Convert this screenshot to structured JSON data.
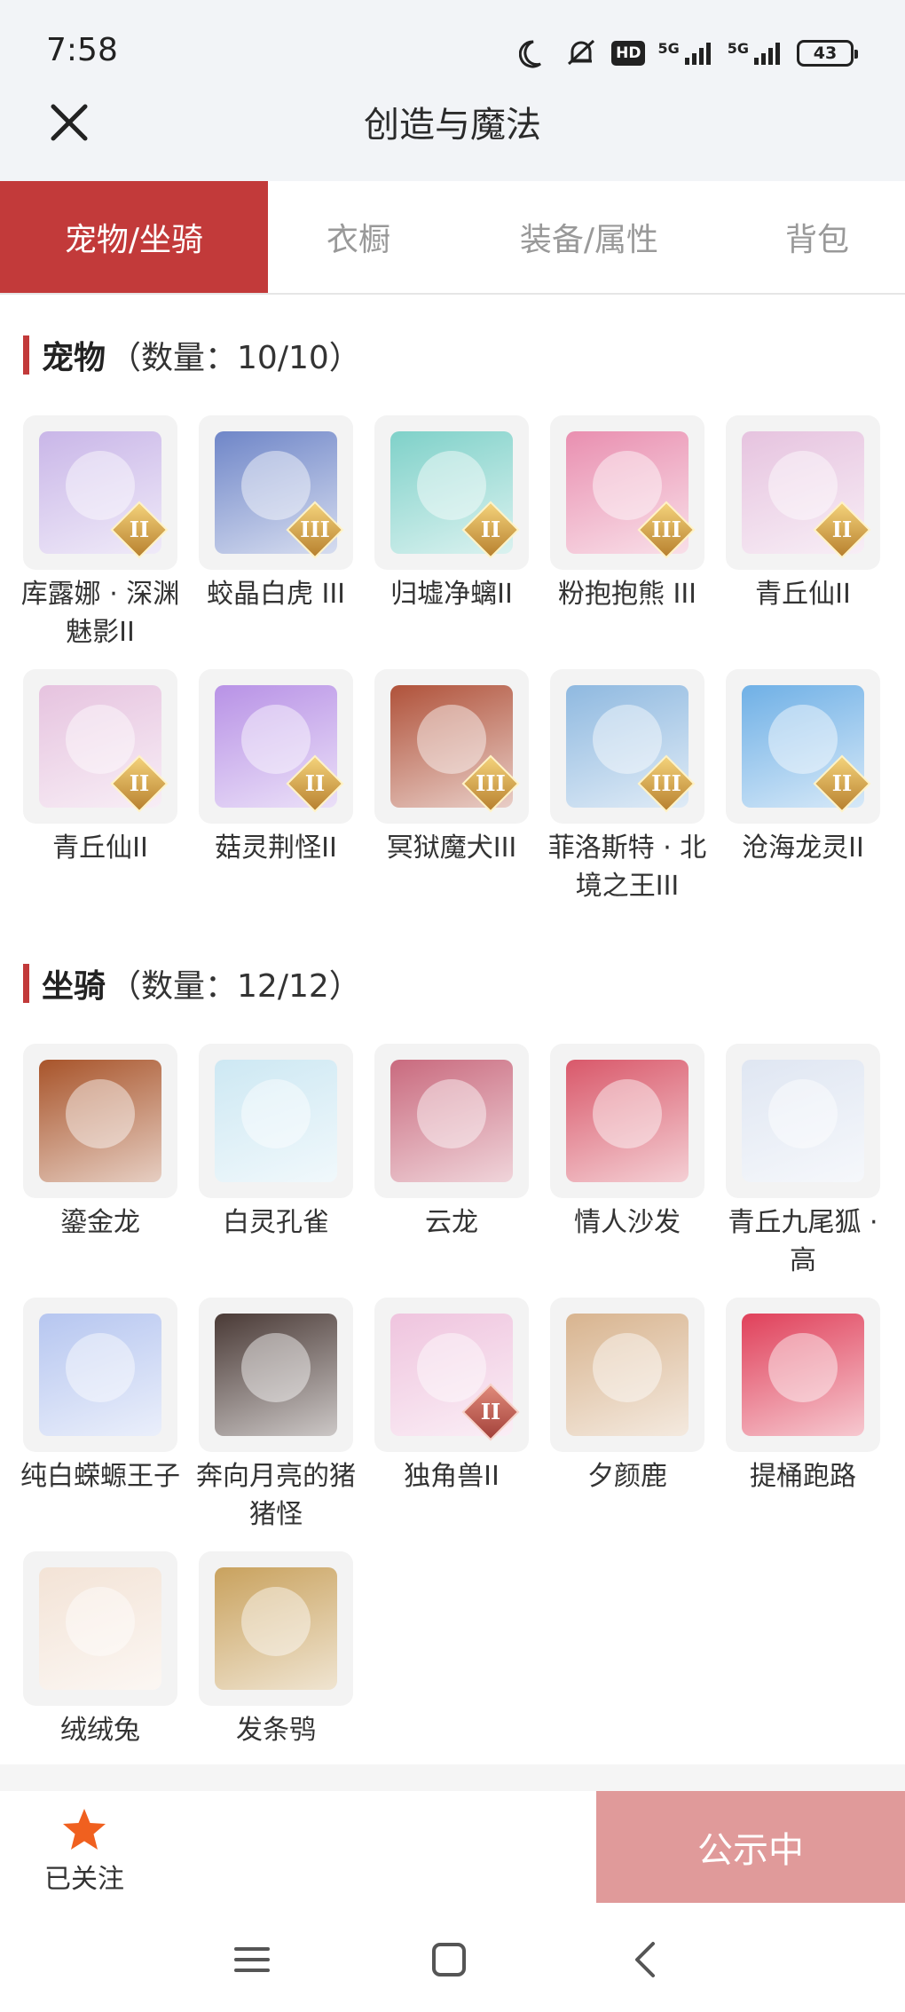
{
  "status_bar": {
    "time": "7:58",
    "hd_label": "HD",
    "signal_1": "5G",
    "signal_2": "5G",
    "battery": "43"
  },
  "header": {
    "title": "创造与魔法"
  },
  "tabs": [
    {
      "label": "宠物/坐骑",
      "active": true
    },
    {
      "label": "衣橱",
      "active": false
    },
    {
      "label": "装备/属性",
      "active": false
    },
    {
      "label": "背包",
      "active": false
    }
  ],
  "pets": {
    "title": "宠物",
    "count_text": "（数量：10/10）",
    "items": [
      {
        "name": "库露娜 · 深渊魅影II",
        "icon": "purple-fairy-pet",
        "badge": "II",
        "color": "#c9b6e8"
      },
      {
        "name": "蛟晶白虎 III",
        "icon": "white-tiger-pet",
        "badge": "III",
        "color": "#6f86c8"
      },
      {
        "name": "归墟净螭II",
        "icon": "teal-dragon-pet",
        "badge": "II",
        "color": "#7fd1c9"
      },
      {
        "name": "粉抱抱熊 III",
        "icon": "pink-bear-pet",
        "badge": "III",
        "color": "#e98fb0"
      },
      {
        "name": "青丘仙II",
        "icon": "fox-fairy-pet",
        "badge": "II",
        "color": "#e6c3df"
      },
      {
        "name": "青丘仙II",
        "icon": "fox-fairy-pet",
        "badge": "II",
        "color": "#e6c3df"
      },
      {
        "name": "菇灵荆怪II",
        "icon": "mushroom-sprite-pet",
        "badge": "II",
        "color": "#b892e6"
      },
      {
        "name": "冥狱魔犬III",
        "icon": "demon-hound-pet",
        "badge": "III",
        "color": "#b0523a"
      },
      {
        "name": "菲洛斯特 · 北境之王III",
        "icon": "ice-king-pet",
        "badge": "III",
        "color": "#8fb9e0"
      },
      {
        "name": "沧海龙灵II",
        "icon": "sea-dragon-spirit-pet",
        "badge": "II",
        "color": "#6fb0e6"
      }
    ]
  },
  "mounts": {
    "title": "坐骑",
    "count_text": "（数量：12/12）",
    "items": [
      {
        "name": "鎏金龙",
        "icon": "golden-dragon-mount",
        "color": "#a8542a"
      },
      {
        "name": "白灵孔雀",
        "icon": "white-peacock-mount",
        "color": "#cde8f3"
      },
      {
        "name": "云龙",
        "icon": "cloud-dragon-mount",
        "color": "#c96a7e"
      },
      {
        "name": "情人沙发",
        "icon": "lover-sofa-mount",
        "color": "#d9586a"
      },
      {
        "name": "青丘九尾狐 · 高",
        "icon": "nine-tail-fox-mount",
        "color": "#dfe6f2"
      },
      {
        "name": "纯白蝾螈王子",
        "icon": "white-axolotl-mount",
        "color": "#b6c6f0"
      },
      {
        "name": "奔向月亮的猪猪怪",
        "icon": "moon-pig-mount",
        "color": "#4a3a36"
      },
      {
        "name": "独角兽II",
        "icon": "unicorn-mount",
        "badge": "II",
        "color": "#efc4de"
      },
      {
        "name": "夕颜鹿",
        "icon": "deer-mount",
        "color": "#d8b48f"
      },
      {
        "name": "提桶跑路",
        "icon": "bucket-mount",
        "color": "#e0405a"
      },
      {
        "name": "绒绒兔",
        "icon": "fluffy-rabbit-mount",
        "color": "#f3e3d6"
      },
      {
        "name": "发条鸮",
        "icon": "clockwork-owl-mount",
        "color": "#c9a25e"
      }
    ]
  },
  "bottom": {
    "follow_label": "已关注",
    "public_label": "公示中"
  },
  "colors": {
    "accent": "#c23a3a",
    "star": "#f0601f",
    "public_btn": "#e09a9a"
  }
}
